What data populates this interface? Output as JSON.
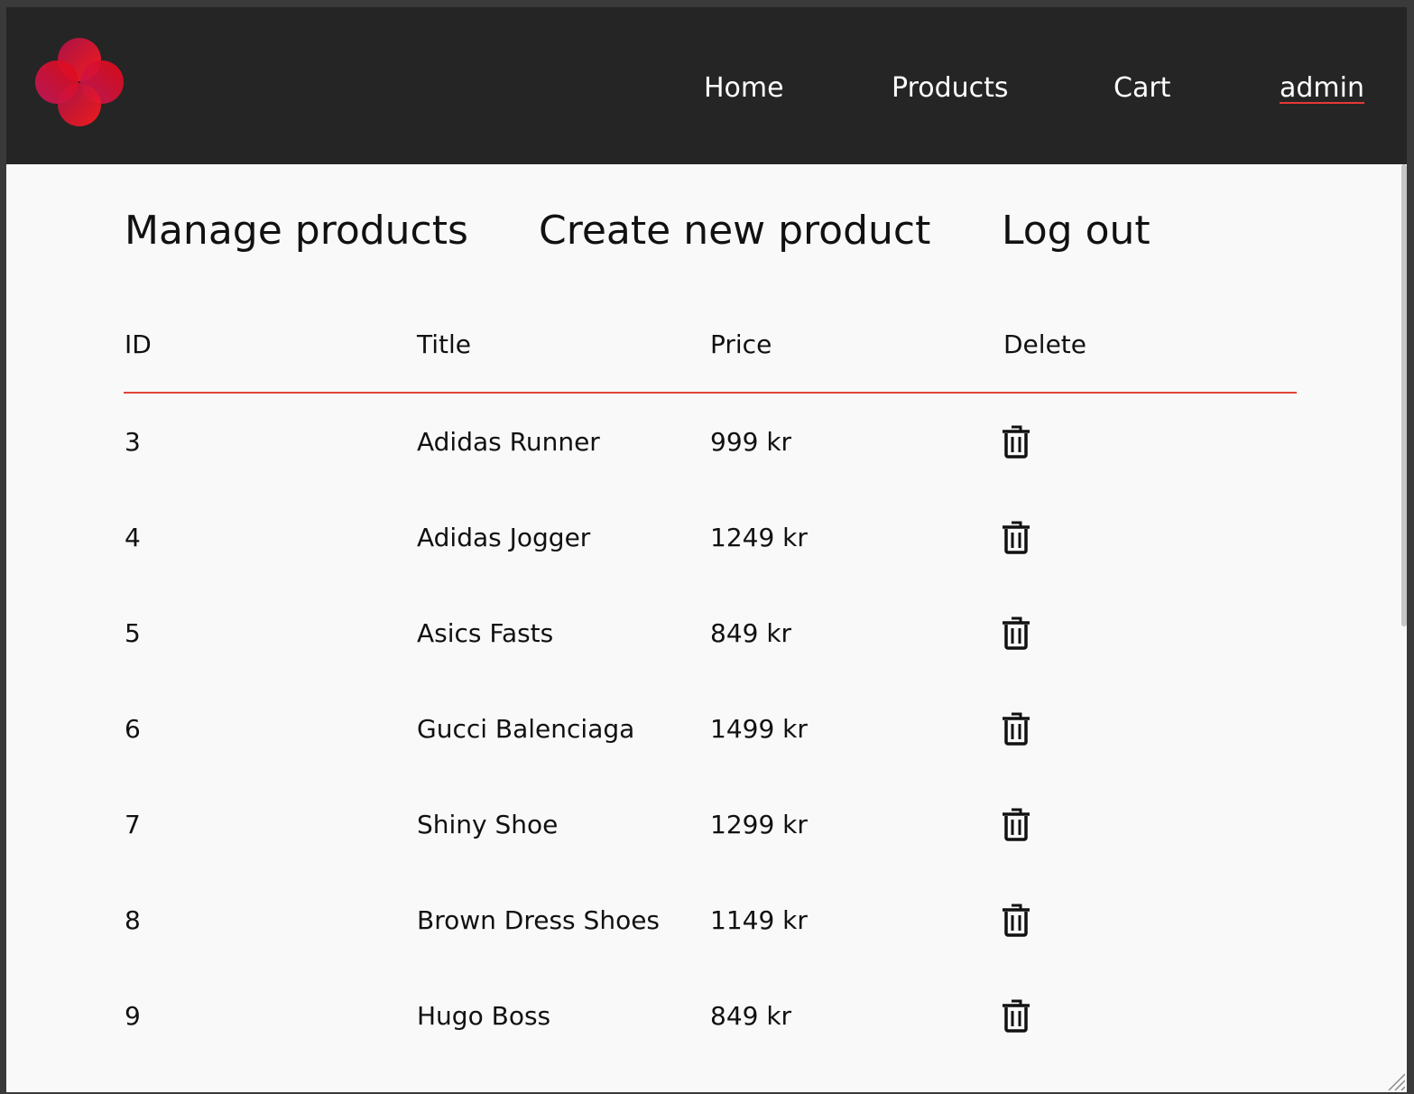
{
  "brand": {
    "logo_icon": "flower-logo-icon",
    "logo_colors": [
      "#e50914",
      "#c2185b",
      "#ff1744"
    ]
  },
  "nav": {
    "items": [
      {
        "label": "Home"
      },
      {
        "label": "Products"
      },
      {
        "label": "Cart"
      },
      {
        "label": "admin"
      }
    ]
  },
  "subnav": {
    "items": [
      {
        "label": "Manage products"
      },
      {
        "label": "Create new product"
      },
      {
        "label": "Log out"
      }
    ]
  },
  "table": {
    "headers": [
      "ID",
      "Title",
      "Price",
      "Delete"
    ],
    "delete_icon": "trash-icon",
    "rows": [
      {
        "id": "3",
        "title": "Adidas Runner",
        "price": "999 kr"
      },
      {
        "id": "4",
        "title": "Adidas Jogger",
        "price": "1249 kr"
      },
      {
        "id": "5",
        "title": "Asics Fasts",
        "price": "849 kr"
      },
      {
        "id": "6",
        "title": "Gucci Balenciaga",
        "price": "1499 kr"
      },
      {
        "id": "7",
        "title": "Shiny Shoe",
        "price": "1299 kr"
      },
      {
        "id": "8",
        "title": "Brown Dress Shoes",
        "price": "1149 kr"
      },
      {
        "id": "9",
        "title": "Hugo Boss",
        "price": "849 kr"
      }
    ]
  },
  "colors": {
    "navbar_bg": "#252525",
    "page_bg": "#f9f9f9",
    "accent": "#e0453a"
  }
}
